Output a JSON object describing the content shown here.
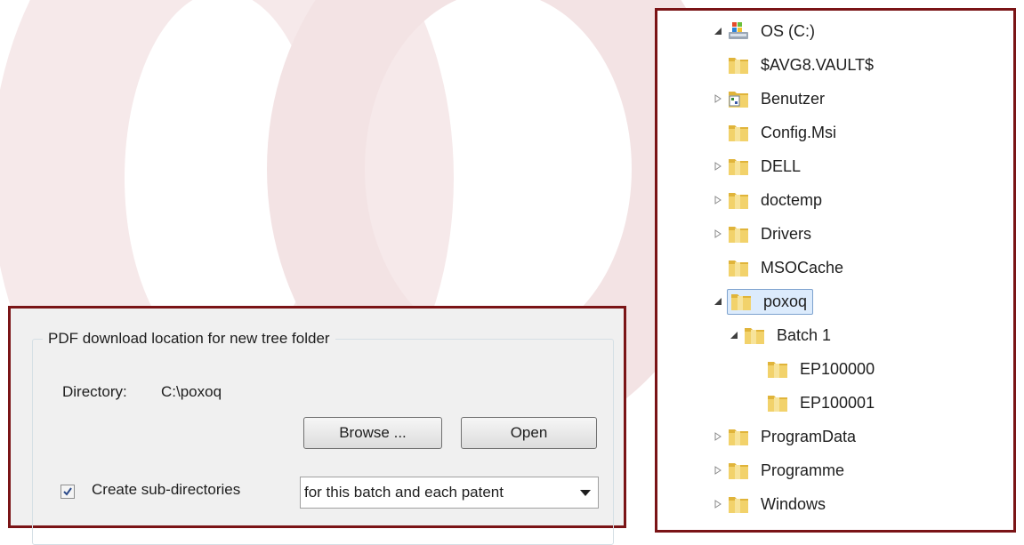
{
  "dialog": {
    "group_title": "PDF download location for new tree folder",
    "directory_label": "Directory:",
    "directory_value": "C:\\poxoq",
    "browse_label": "Browse ...",
    "open_label": "Open",
    "create_subdirs_label": "Create sub-directories",
    "create_subdirs_checked": true,
    "subdirs_option": "for this batch and each patent"
  },
  "tree": {
    "root": "OS (C:)",
    "items": [
      {
        "label": "$AVG8.VAULT$"
      },
      {
        "label": "Benutzer"
      },
      {
        "label": "Config.Msi"
      },
      {
        "label": "DELL"
      },
      {
        "label": "doctemp"
      },
      {
        "label": "Drivers"
      },
      {
        "label": "MSOCache"
      },
      {
        "label": "poxoq"
      },
      {
        "label": "Batch 1"
      },
      {
        "label": "EP100000"
      },
      {
        "label": "EP100001"
      },
      {
        "label": "ProgramData"
      },
      {
        "label": "Programme"
      },
      {
        "label": "Windows"
      }
    ]
  },
  "colors": {
    "panel_border": "#7a1416",
    "selection": "#dcebfc",
    "folder": "#e8c040"
  }
}
